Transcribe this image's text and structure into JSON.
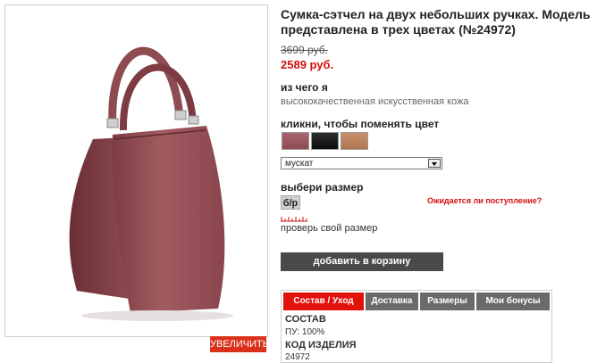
{
  "product": {
    "title": "Сумка-сэтчел на двух небольших ручках. Модель представлена в трех цветах (№24972)",
    "old_price": "3699 руб.",
    "new_price": "2589 руб.",
    "zoom_label": "УВЕЛИЧИТЬ"
  },
  "material": {
    "heading": "из чего я",
    "value": "высококачественная искусственная кожа"
  },
  "color": {
    "heading": "кликни, чтобы поменять цвет",
    "swatches": [
      "mauve",
      "black",
      "tan"
    ],
    "selected": "мускат"
  },
  "size": {
    "heading": "выбери размер",
    "chip": "б/р",
    "waiting_link": "Ожидается ли поступление?",
    "check_link": "проверь свой размер"
  },
  "cart_button": "добавить в корзину",
  "tabs": [
    {
      "label": "Состав / Уход",
      "active": true
    },
    {
      "label": "Доставка",
      "active": false
    },
    {
      "label": "Размеры",
      "active": false
    },
    {
      "label": "Мои бонусы",
      "active": false
    }
  ],
  "details": {
    "composition_heading": "СОСТАВ",
    "composition_value": "ПУ: 100%",
    "code_heading": "КОД ИЗДЕЛИЯ",
    "code_value": "24972"
  },
  "colors": {
    "price_red": "#d10f0f",
    "tab_active": "#e3110c",
    "tab_inactive": "#6a6a6a",
    "button_dark": "#4a4a4a",
    "bag": "#9b5559"
  }
}
